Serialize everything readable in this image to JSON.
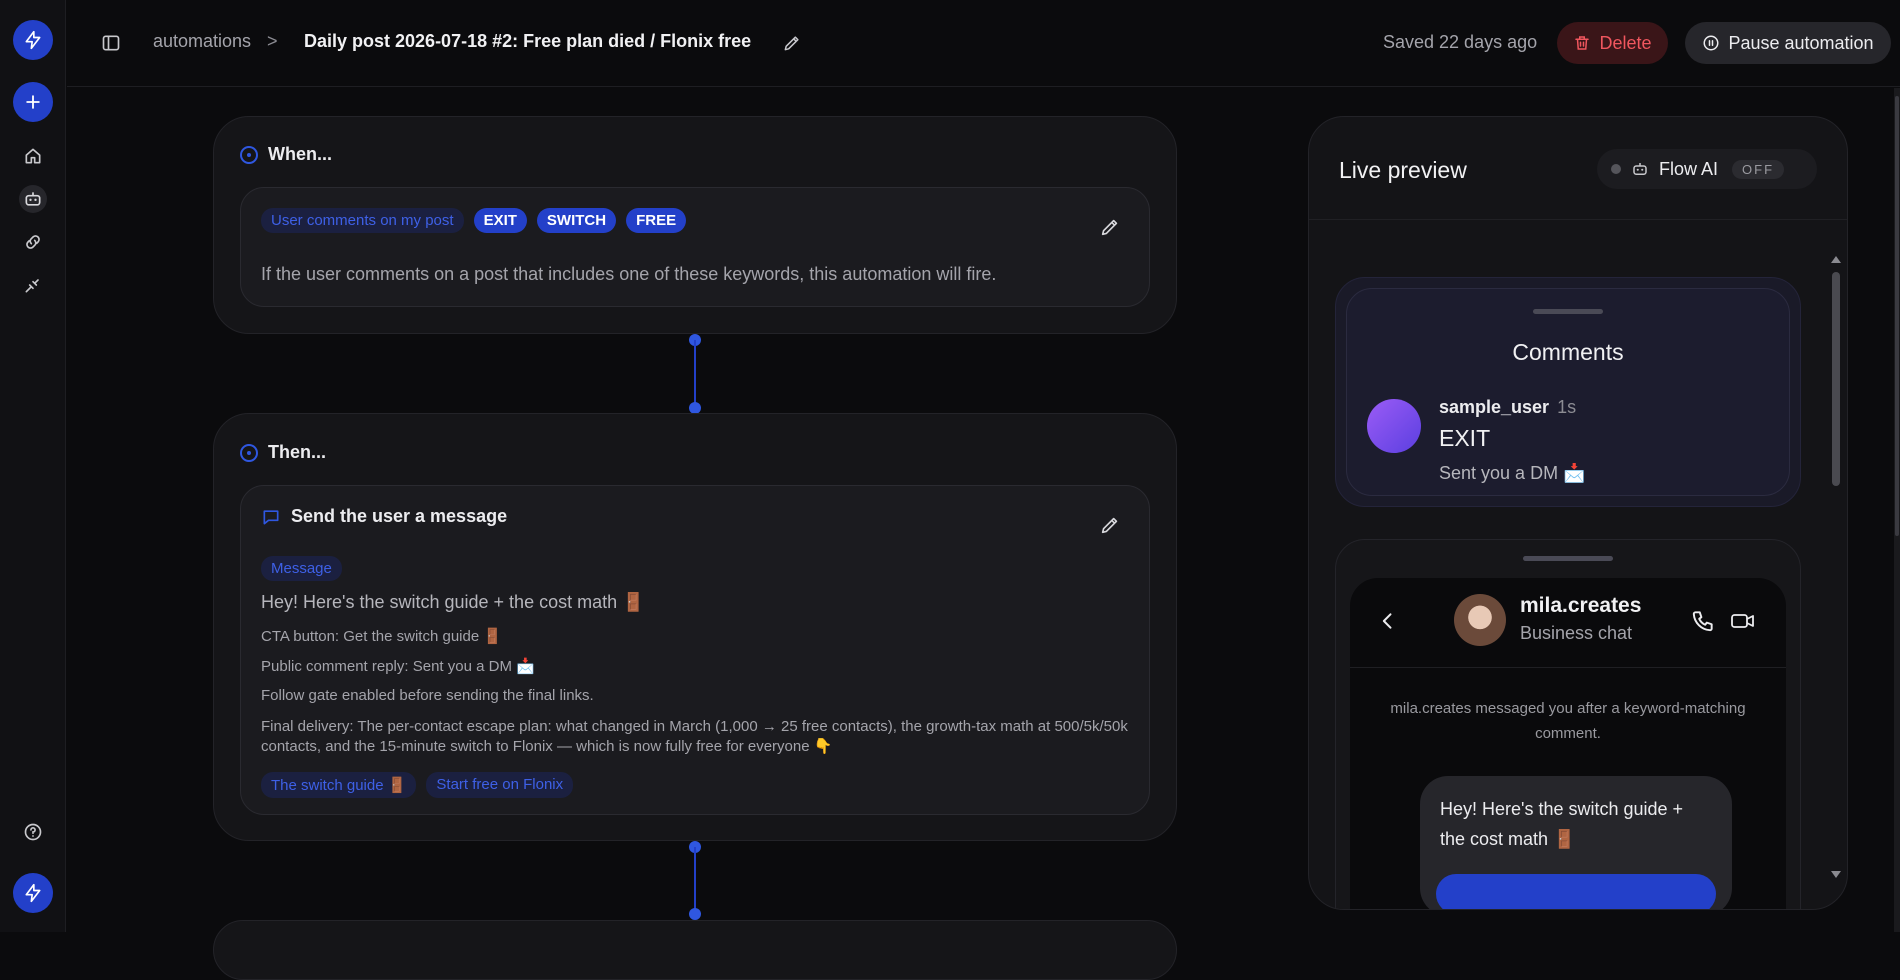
{
  "topbar": {
    "breadcrumb_root": "automations",
    "breadcrumb_sep": ">",
    "title": "Daily post 2026-07-18 #2: Free plan died / Flonix free",
    "saved": "Saved 22 days ago",
    "delete_label": "Delete",
    "pause_label": "Pause automation"
  },
  "when": {
    "heading": "When...",
    "trigger_label": "User comments on my post",
    "keywords": [
      "EXIT",
      "SWITCH",
      "FREE"
    ],
    "description": "If the user comments on a post that includes one of these keywords, this automation will fire."
  },
  "then": {
    "heading": "Then...",
    "action_title": "Send the user a message",
    "tag": "Message",
    "message": "Hey! Here's the switch guide + the cost math 🚪",
    "cta": "CTA button: Get the switch guide 🚪",
    "public_reply": "Public comment reply: Sent you a DM 📩",
    "follow_gate": "Follow gate enabled before sending the final links.",
    "final_delivery": "Final delivery: The per-contact escape plan: what changed in March (1,000 → 25 free contacts), the growth-tax math at 500/5k/50k contacts, and the 15-minute switch to Flonix — which is now fully free for everyone 👇",
    "links": [
      "The switch guide 🚪",
      "Start free on Flonix"
    ]
  },
  "preview": {
    "title": "Live preview",
    "flow_ai_label": "Flow AI",
    "flow_ai_state": "OFF",
    "comments_title": "Comments",
    "comment_user": "sample_user",
    "comment_time": "1s",
    "comment_text": "EXIT",
    "comment_reply": "Sent you a DM 📩",
    "dm_name": "mila.creates",
    "dm_sub": "Business chat",
    "dm_note": "mila.creates messaged you after a keyword-matching comment.",
    "dm_bubble": "Hey! Here's the switch guide + the cost math 🚪"
  },
  "colors": {
    "accent": "#2340c9",
    "accent_text": "#3e60e6",
    "danger": "#f0565e",
    "background": "#0b0b0d"
  }
}
